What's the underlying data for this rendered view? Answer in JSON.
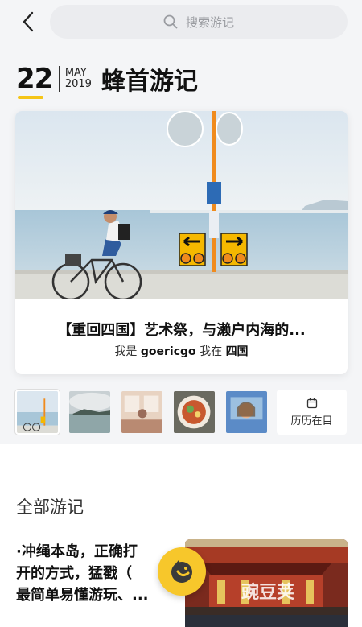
{
  "header": {
    "search_placeholder": "搜索游记"
  },
  "date": {
    "day": "22",
    "month": "MAY",
    "year": "2019",
    "title": "蜂首游记"
  },
  "featured": {
    "title": "【重回四国】艺术祭，与濑户内海的...",
    "prefix": "我是",
    "author": "goericgo",
    "middle": "我在",
    "location": "四国"
  },
  "history_label": "历历在目",
  "section_title": "全部游记",
  "article": {
    "line1": "·冲绳本岛，正确打",
    "line2": "开的方式，猛戳（",
    "line3": "最简单易懂游玩、..."
  },
  "watermark": "豌豆荚",
  "colors": {
    "accent": "#f7c72b",
    "background": "#f4f5f7"
  }
}
